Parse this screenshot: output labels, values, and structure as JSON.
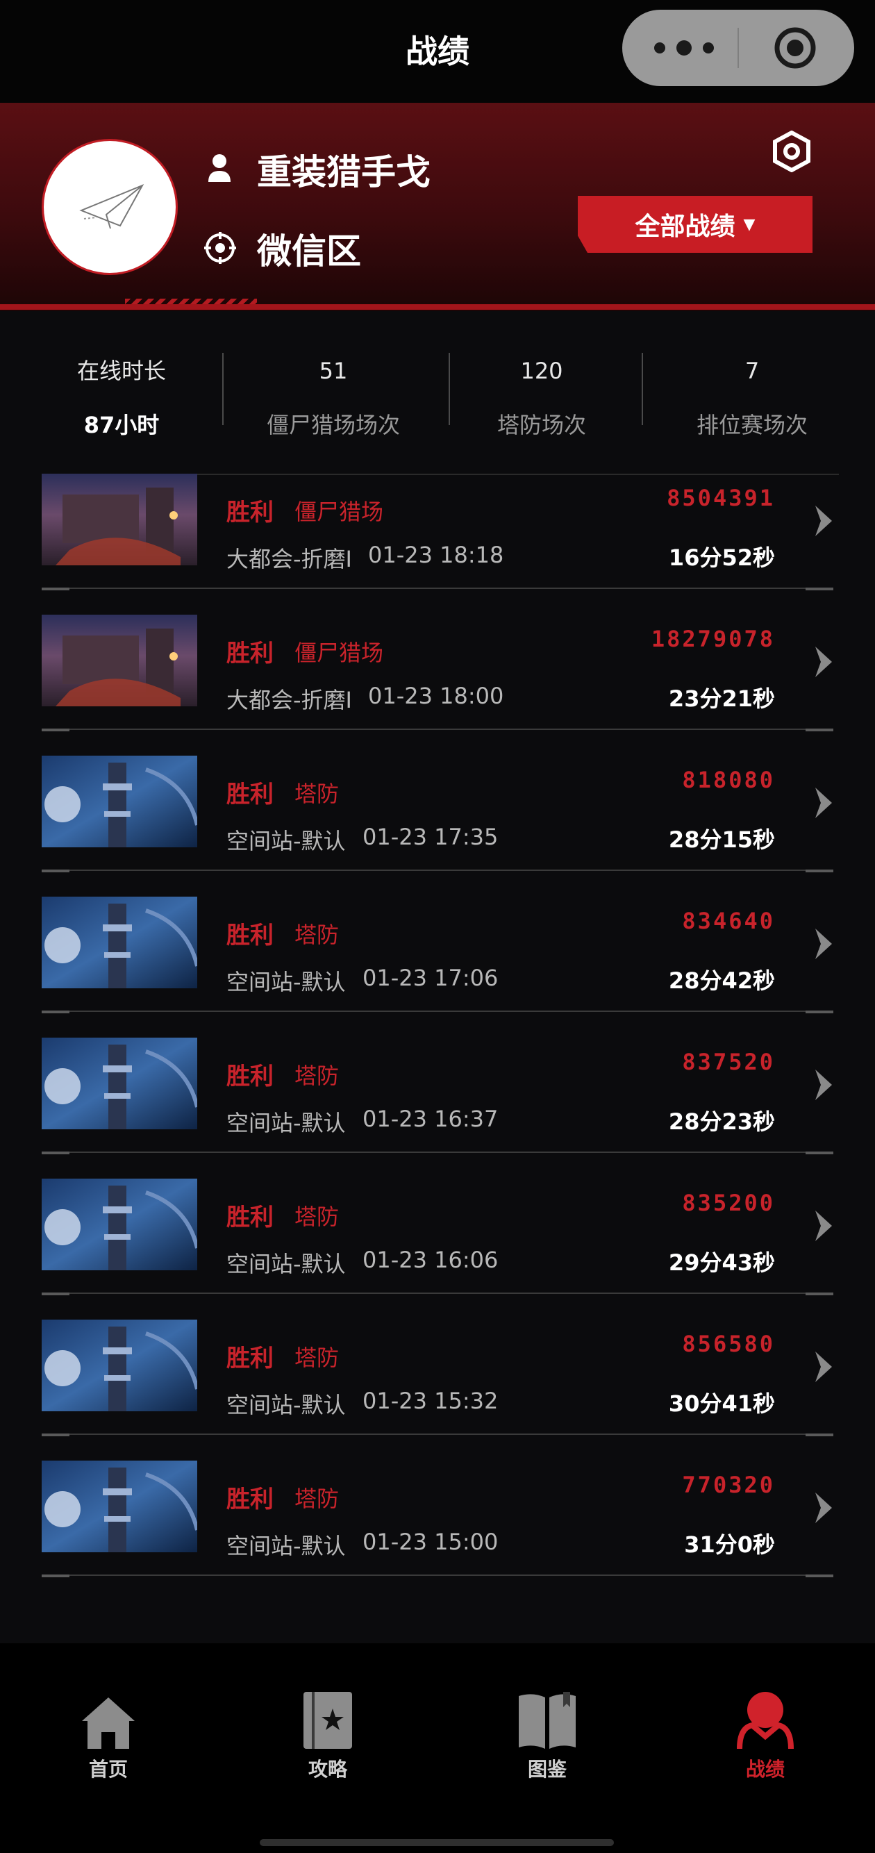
{
  "topbar": {
    "title": "战绩"
  },
  "profile": {
    "username": "重装猎手戈",
    "region": "微信区",
    "filter_label": "全部战绩",
    "filter_caret": "▼"
  },
  "stats": [
    {
      "top": "在线时长",
      "bottom": "87小时"
    },
    {
      "top": "51",
      "bottom": "僵尸猎场场次"
    },
    {
      "top": "120",
      "bottom": "塔防场次"
    },
    {
      "top": "7",
      "bottom": "排位赛场次"
    }
  ],
  "matches": [
    {
      "result": "胜利",
      "mode": "僵尸猎场",
      "map": "大都会-折磨I",
      "time": "01-23 18:18",
      "score": "8504391",
      "duration": "16分52秒",
      "thumb": "city"
    },
    {
      "result": "胜利",
      "mode": "僵尸猎场",
      "map": "大都会-折磨I",
      "time": "01-23 18:00",
      "score": "18279078",
      "duration": "23分21秒",
      "thumb": "city"
    },
    {
      "result": "胜利",
      "mode": "塔防",
      "map": "空间站-默认",
      "time": "01-23 17:35",
      "score": "818080",
      "duration": "28分15秒",
      "thumb": "space"
    },
    {
      "result": "胜利",
      "mode": "塔防",
      "map": "空间站-默认",
      "time": "01-23 17:06",
      "score": "834640",
      "duration": "28分42秒",
      "thumb": "space"
    },
    {
      "result": "胜利",
      "mode": "塔防",
      "map": "空间站-默认",
      "time": "01-23 16:37",
      "score": "837520",
      "duration": "28分23秒",
      "thumb": "space"
    },
    {
      "result": "胜利",
      "mode": "塔防",
      "map": "空间站-默认",
      "time": "01-23 16:06",
      "score": "835200",
      "duration": "29分43秒",
      "thumb": "space"
    },
    {
      "result": "胜利",
      "mode": "塔防",
      "map": "空间站-默认",
      "time": "01-23 15:32",
      "score": "856580",
      "duration": "30分41秒",
      "thumb": "space"
    },
    {
      "result": "胜利",
      "mode": "塔防",
      "map": "空间站-默认",
      "time": "01-23 15:00",
      "score": "770320",
      "duration": "31分0秒",
      "thumb": "space"
    }
  ],
  "nav": [
    {
      "label": "首页",
      "icon": "home-icon",
      "active": false
    },
    {
      "label": "攻略",
      "icon": "guide-book-icon",
      "active": false
    },
    {
      "label": "图鉴",
      "icon": "open-book-icon",
      "active": false
    },
    {
      "label": "战绩",
      "icon": "profile-icon",
      "active": true
    }
  ],
  "colors": {
    "accent": "#c8232b",
    "background": "#0b0b0d",
    "header": "#5a0f13"
  }
}
